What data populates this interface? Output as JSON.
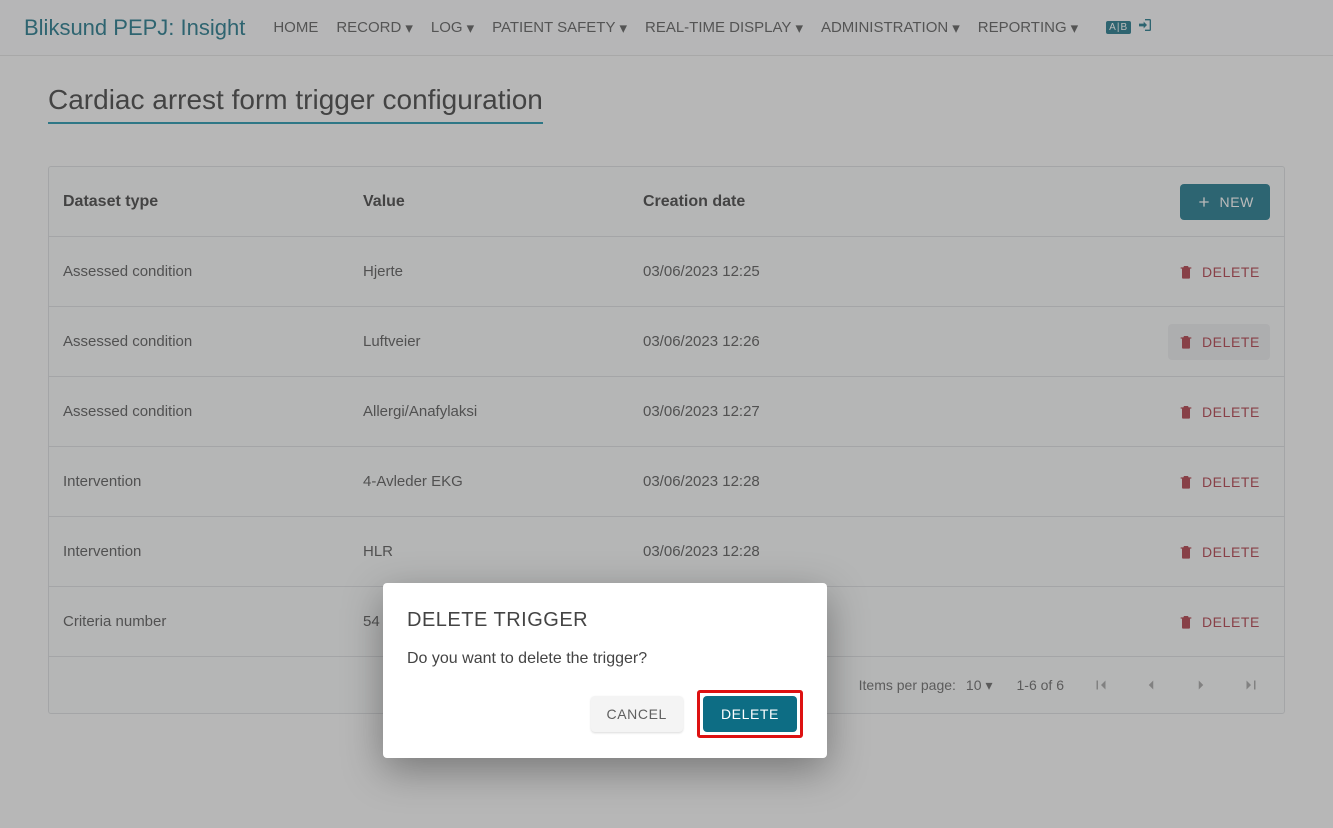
{
  "nav": {
    "brand": "Bliksund PEPJ: Insight",
    "home": "HOME",
    "record": "RECORD",
    "log": "LOG",
    "patient_safety": "PATIENT SAFETY",
    "real_time": "REAL-TIME DISPLAY",
    "administration": "ADMINISTRATION",
    "reporting": "REPORTING",
    "lang_badge": "A|B"
  },
  "page_title": "Cardiac arrest form trigger configuration",
  "table": {
    "headers": {
      "dataset_type": "Dataset type",
      "value": "Value",
      "creation_date": "Creation date"
    },
    "new_label": "NEW",
    "delete_label": "DELETE",
    "rows": [
      {
        "type": "Assessed condition",
        "value": "Hjerte",
        "date": "03/06/2023 12:25"
      },
      {
        "type": "Assessed condition",
        "value": "Luftveier",
        "date": "03/06/2023 12:26"
      },
      {
        "type": "Assessed condition",
        "value": "Allergi/Anafylaksi",
        "date": "03/06/2023 12:27"
      },
      {
        "type": "Intervention",
        "value": "4-Avleder EKG",
        "date": "03/06/2023 12:28"
      },
      {
        "type": "Intervention",
        "value": "HLR",
        "date": "03/06/2023 12:28"
      },
      {
        "type": "Criteria number",
        "value": "54",
        "date": ""
      }
    ]
  },
  "pager": {
    "items_per_page_label": "Items per page:",
    "items_per_page_value": "10",
    "range": "1-6 of 6"
  },
  "dialog": {
    "title": "DELETE TRIGGER",
    "body": "Do you want to delete the trigger?",
    "cancel": "CANCEL",
    "confirm": "DELETE"
  }
}
